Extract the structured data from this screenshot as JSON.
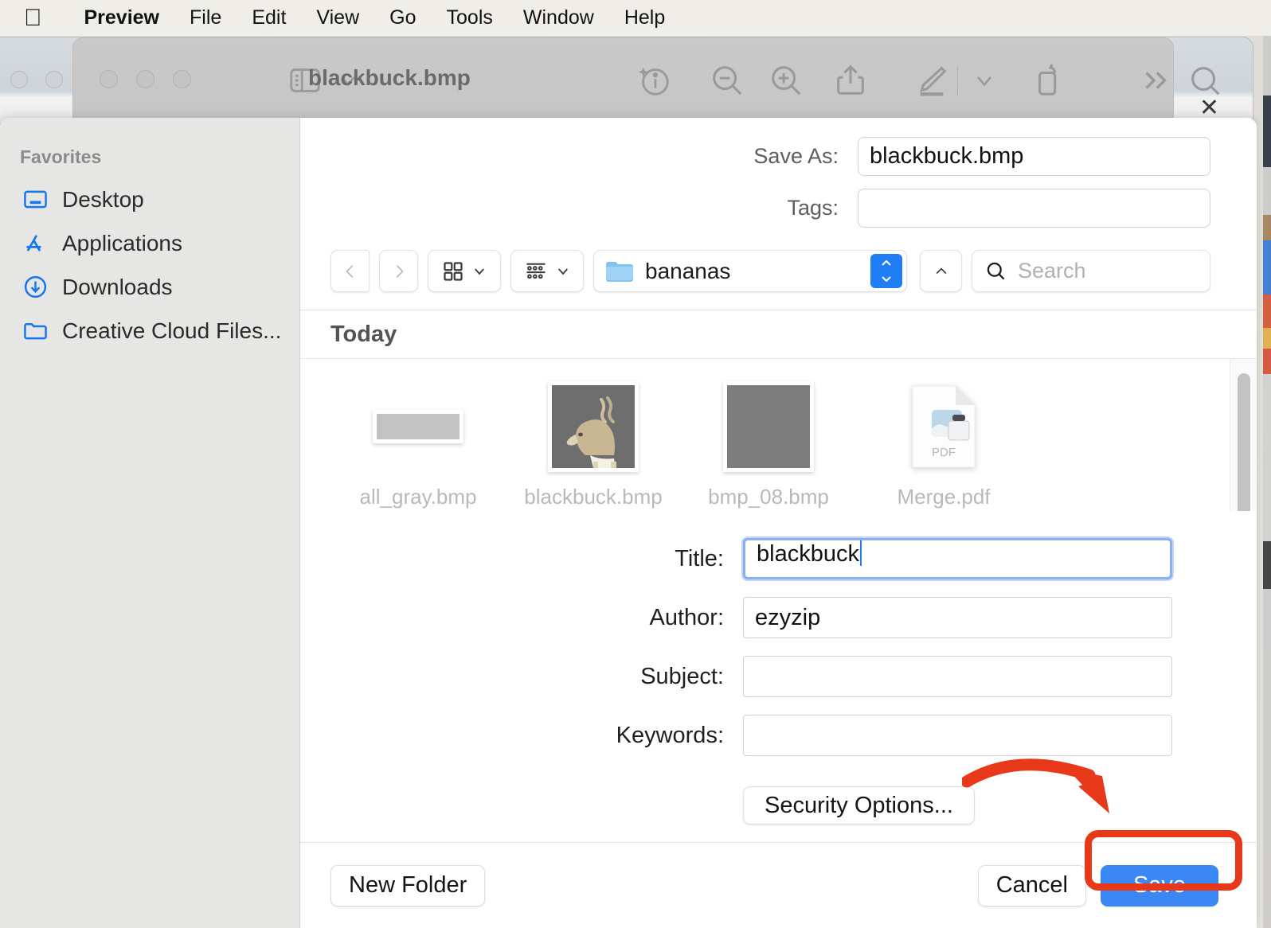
{
  "menubar": {
    "apple_icon": "apple-logo-icon",
    "items": [
      {
        "label": "Preview",
        "bold": true
      },
      {
        "label": "File"
      },
      {
        "label": "Edit"
      },
      {
        "label": "View"
      },
      {
        "label": "Go"
      },
      {
        "label": "Tools"
      },
      {
        "label": "Window"
      },
      {
        "label": "Help"
      }
    ]
  },
  "preview_window": {
    "title": "blackbuck.bmp",
    "toolbar_icons": [
      "sidebar-icon",
      "chevron-down-icon",
      "markup-info-icon",
      "zoom-out-icon",
      "zoom-in-icon",
      "share-icon",
      "annotate-pencil-icon",
      "chevron-down-icon",
      "rotate-icon",
      "more-chevrons-icon",
      "search-icon"
    ],
    "close_label": "✕"
  },
  "sidebar": {
    "header": "Favorites",
    "items": [
      {
        "label": "Desktop",
        "icon": "desktop-icon"
      },
      {
        "label": "Applications",
        "icon": "applications-icon"
      },
      {
        "label": "Downloads",
        "icon": "downloads-icon"
      },
      {
        "label": "Creative Cloud Files...",
        "icon": "folder-icon"
      }
    ]
  },
  "save_fields": {
    "save_as_label": "Save As:",
    "save_as_value": "blackbuck.bmp",
    "tags_label": "Tags:",
    "tags_value": "",
    "tags_placeholder": ""
  },
  "navbar": {
    "back_icon": "chevron-left-icon",
    "forward_icon": "chevron-right-icon",
    "grid_view_icon": "grid-view-icon",
    "list_view_icon": "list-view-icon",
    "path_folder_icon": "folder-icon",
    "path_value": "bananas",
    "stepper_icon": "up-down-stepper-icon",
    "up_dir_icon": "chevron-up-icon",
    "search_icon": "search-icon",
    "search_placeholder": "Search",
    "search_value": ""
  },
  "browser": {
    "group_label": "Today",
    "files": [
      {
        "name": "all_gray.bmp",
        "kind": "wide-gray-bitmap"
      },
      {
        "name": "blackbuck.bmp",
        "kind": "blackbuck-photo"
      },
      {
        "name": "bmp_08.bmp",
        "kind": "solid-gray-bitmap"
      },
      {
        "name": "Merge.pdf",
        "kind": "pdf-document",
        "badge": "PDF"
      }
    ]
  },
  "metadata": {
    "fields": [
      {
        "label": "Title:",
        "value": "blackbuck",
        "focused": true
      },
      {
        "label": "Author:",
        "value": "ezyzip",
        "focused": false
      },
      {
        "label": "Subject:",
        "value": "",
        "focused": false
      },
      {
        "label": "Keywords:",
        "value": "",
        "focused": false
      }
    ],
    "security_options_label": "Security Options..."
  },
  "footer": {
    "new_folder_label": "New Folder",
    "cancel_label": "Cancel",
    "save_label": "Save"
  },
  "annotation": {
    "highlight_color": "#e8381a",
    "arrow_color": "#e8381a",
    "target": "save-button"
  },
  "colors": {
    "accent_blue": "#3b87f4",
    "sidebar_icon_blue": "#1676ef",
    "stepper_blue": "#1f7ef5",
    "annotation_red": "#e8381a"
  }
}
